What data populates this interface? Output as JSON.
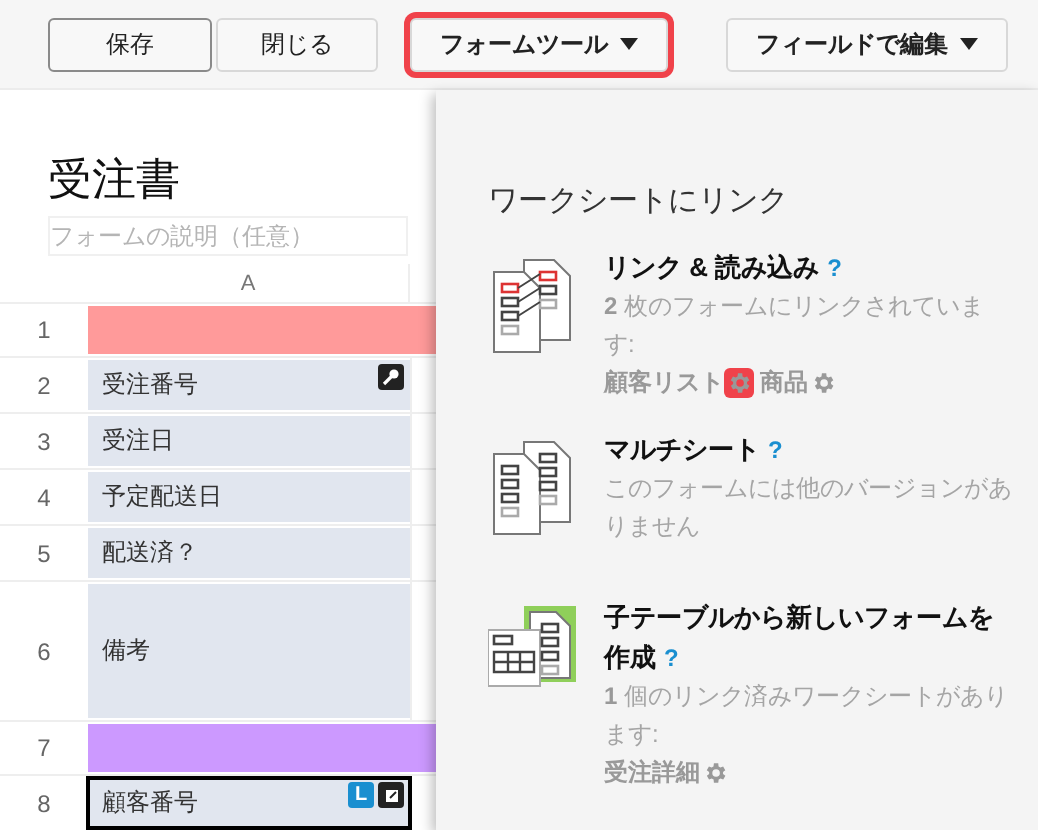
{
  "toolbar": {
    "buttons": [
      {
        "label": "保存",
        "kind": "plain",
        "emphasized": true,
        "highlighted": false,
        "dropdown": false
      },
      {
        "label": "閉じる",
        "kind": "plain",
        "emphasized": false,
        "highlighted": false,
        "dropdown": false
      },
      {
        "label": "フォームツール",
        "kind": "menu",
        "emphasized": false,
        "highlighted": true,
        "dropdown": true
      },
      {
        "label": "フィールドで編集",
        "kind": "menu",
        "emphasized": false,
        "highlighted": false,
        "dropdown": true
      }
    ]
  },
  "form": {
    "title": "受注書",
    "description_placeholder": "フォームの説明（任意）"
  },
  "sheet": {
    "column_header": "A",
    "rows": [
      {
        "number": "1",
        "kind": "band",
        "color": "#ff9a9a",
        "selected": false
      },
      {
        "number": "2",
        "kind": "field",
        "label": "受注番号",
        "selected": false,
        "badges": [
          {
            "kind": "key"
          }
        ]
      },
      {
        "number": "3",
        "kind": "field",
        "label": "受注日",
        "selected": false
      },
      {
        "number": "4",
        "kind": "field",
        "label": "予定配送日",
        "selected": false
      },
      {
        "number": "5",
        "kind": "field",
        "label": "配送済？",
        "selected": false
      },
      {
        "number": "6",
        "kind": "memo",
        "label": "備考",
        "selected": false
      },
      {
        "number": "7",
        "kind": "band",
        "color": "#cc99ff",
        "selected": false
      },
      {
        "number": "8",
        "kind": "field",
        "label": "顧客番号",
        "selected": true,
        "badges": [
          {
            "kind": "letter",
            "text": "L"
          },
          {
            "kind": "expand"
          }
        ]
      }
    ]
  },
  "menu": {
    "heading": "ワークシートにリンク",
    "items": [
      {
        "kind": "link",
        "title": "リンク & 読み込み",
        "help": "?",
        "description": "**2** 枚のフォームにリンクされています:",
        "links": [
          {
            "name": "顧客リスト",
            "highlighted": true
          },
          {
            "name": "商品",
            "highlighted": false
          }
        ]
      },
      {
        "kind": "multi",
        "title": "マルチシート",
        "help": "?",
        "description": "このフォームには他のバージョンがありません"
      },
      {
        "kind": "child",
        "title": "子テーブルから新しいフォームを作成",
        "help": "?",
        "description": "**1** 個のリンク済みワークシートがあります:",
        "links": [
          {
            "name": "受注詳細",
            "highlighted": false
          }
        ]
      }
    ]
  }
}
